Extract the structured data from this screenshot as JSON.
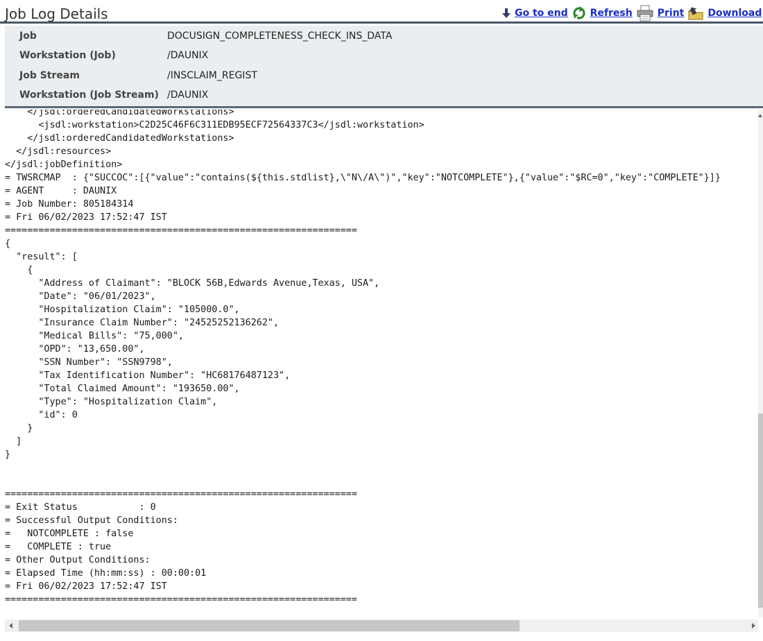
{
  "page": {
    "title": "Job Log Details"
  },
  "toolbar": {
    "go_to_end": "Go to end",
    "refresh": "Refresh",
    "print": "Print",
    "download": "Download"
  },
  "info": {
    "rows": [
      {
        "label": "Job",
        "value": "DOCUSIGN_COMPLETENESS_CHECK_INS_DATA"
      },
      {
        "label": "Workstation (Job)",
        "value": "/DAUNIX"
      },
      {
        "label": "Job Stream",
        "value": "/INSCLAIM_REGIST"
      },
      {
        "label": "Workstation (Job Stream)",
        "value": "/DAUNIX"
      }
    ]
  },
  "log": {
    "lines": [
      "    </jsdl:orderedCandidatedWorkstations>",
      "      <jsdl:workstation>C2D25C46F6C311EDB95ECF72564337C3</jsdl:workstation>",
      "    </jsdl:orderedCandidatedWorkstations>",
      "  </jsdl:resources>",
      "</jsdl:jobDefinition>",
      "= TWSRCMAP  : {\"SUCCOC\":[{\"value\":\"contains(${this.stdlist},\\\"N\\/A\\\")\",\"key\":\"NOTCOMPLETE\"},{\"value\":\"$RC=0\",\"key\":\"COMPLETE\"}]}",
      "= AGENT     : DAUNIX",
      "= Job Number: 805184314",
      "= Fri 06/02/2023 17:52:47 IST",
      "===============================================================",
      "{",
      "  \"result\": [",
      "    {",
      "      \"Address of Claimant\": \"BLOCK 56B,Edwards Avenue,Texas, USA\",",
      "      \"Date\": \"06/01/2023\",",
      "      \"Hospitalization Claim\": \"105000.0\",",
      "      \"Insurance Claim Number\": \"24525252136262\",",
      "      \"Medical Bills\": \"75,000\",",
      "      \"OPD\": \"13,650.00\",",
      "      \"SSN Number\": \"SSN9798\",",
      "      \"Tax Identification Number\": \"HC68176487123\",",
      "      \"Total Claimed Amount\": \"193650.00\",",
      "      \"Type\": \"Hospitalization Claim\",",
      "      \"id\": 0",
      "    }",
      "  ]",
      "}",
      "",
      "",
      "===============================================================",
      "= Exit Status           : 0",
      "= Successful Output Conditions:",
      "=   NOTCOMPLETE : false",
      "=   COMPLETE : true",
      "= Other Output Conditions:",
      "= Elapsed Time (hh:mm:ss) : 00:00:01",
      "= Fri 06/02/2023 17:52:47 IST",
      "==============================================================="
    ]
  },
  "icons": {
    "go_to_end": "arrow-down-icon",
    "refresh": "refresh-icon",
    "print": "printer-icon",
    "download": "download-icon"
  },
  "colors": {
    "link": "#1a2ec4",
    "info_bg": "#ebeef0",
    "divider": "#4a5566"
  }
}
